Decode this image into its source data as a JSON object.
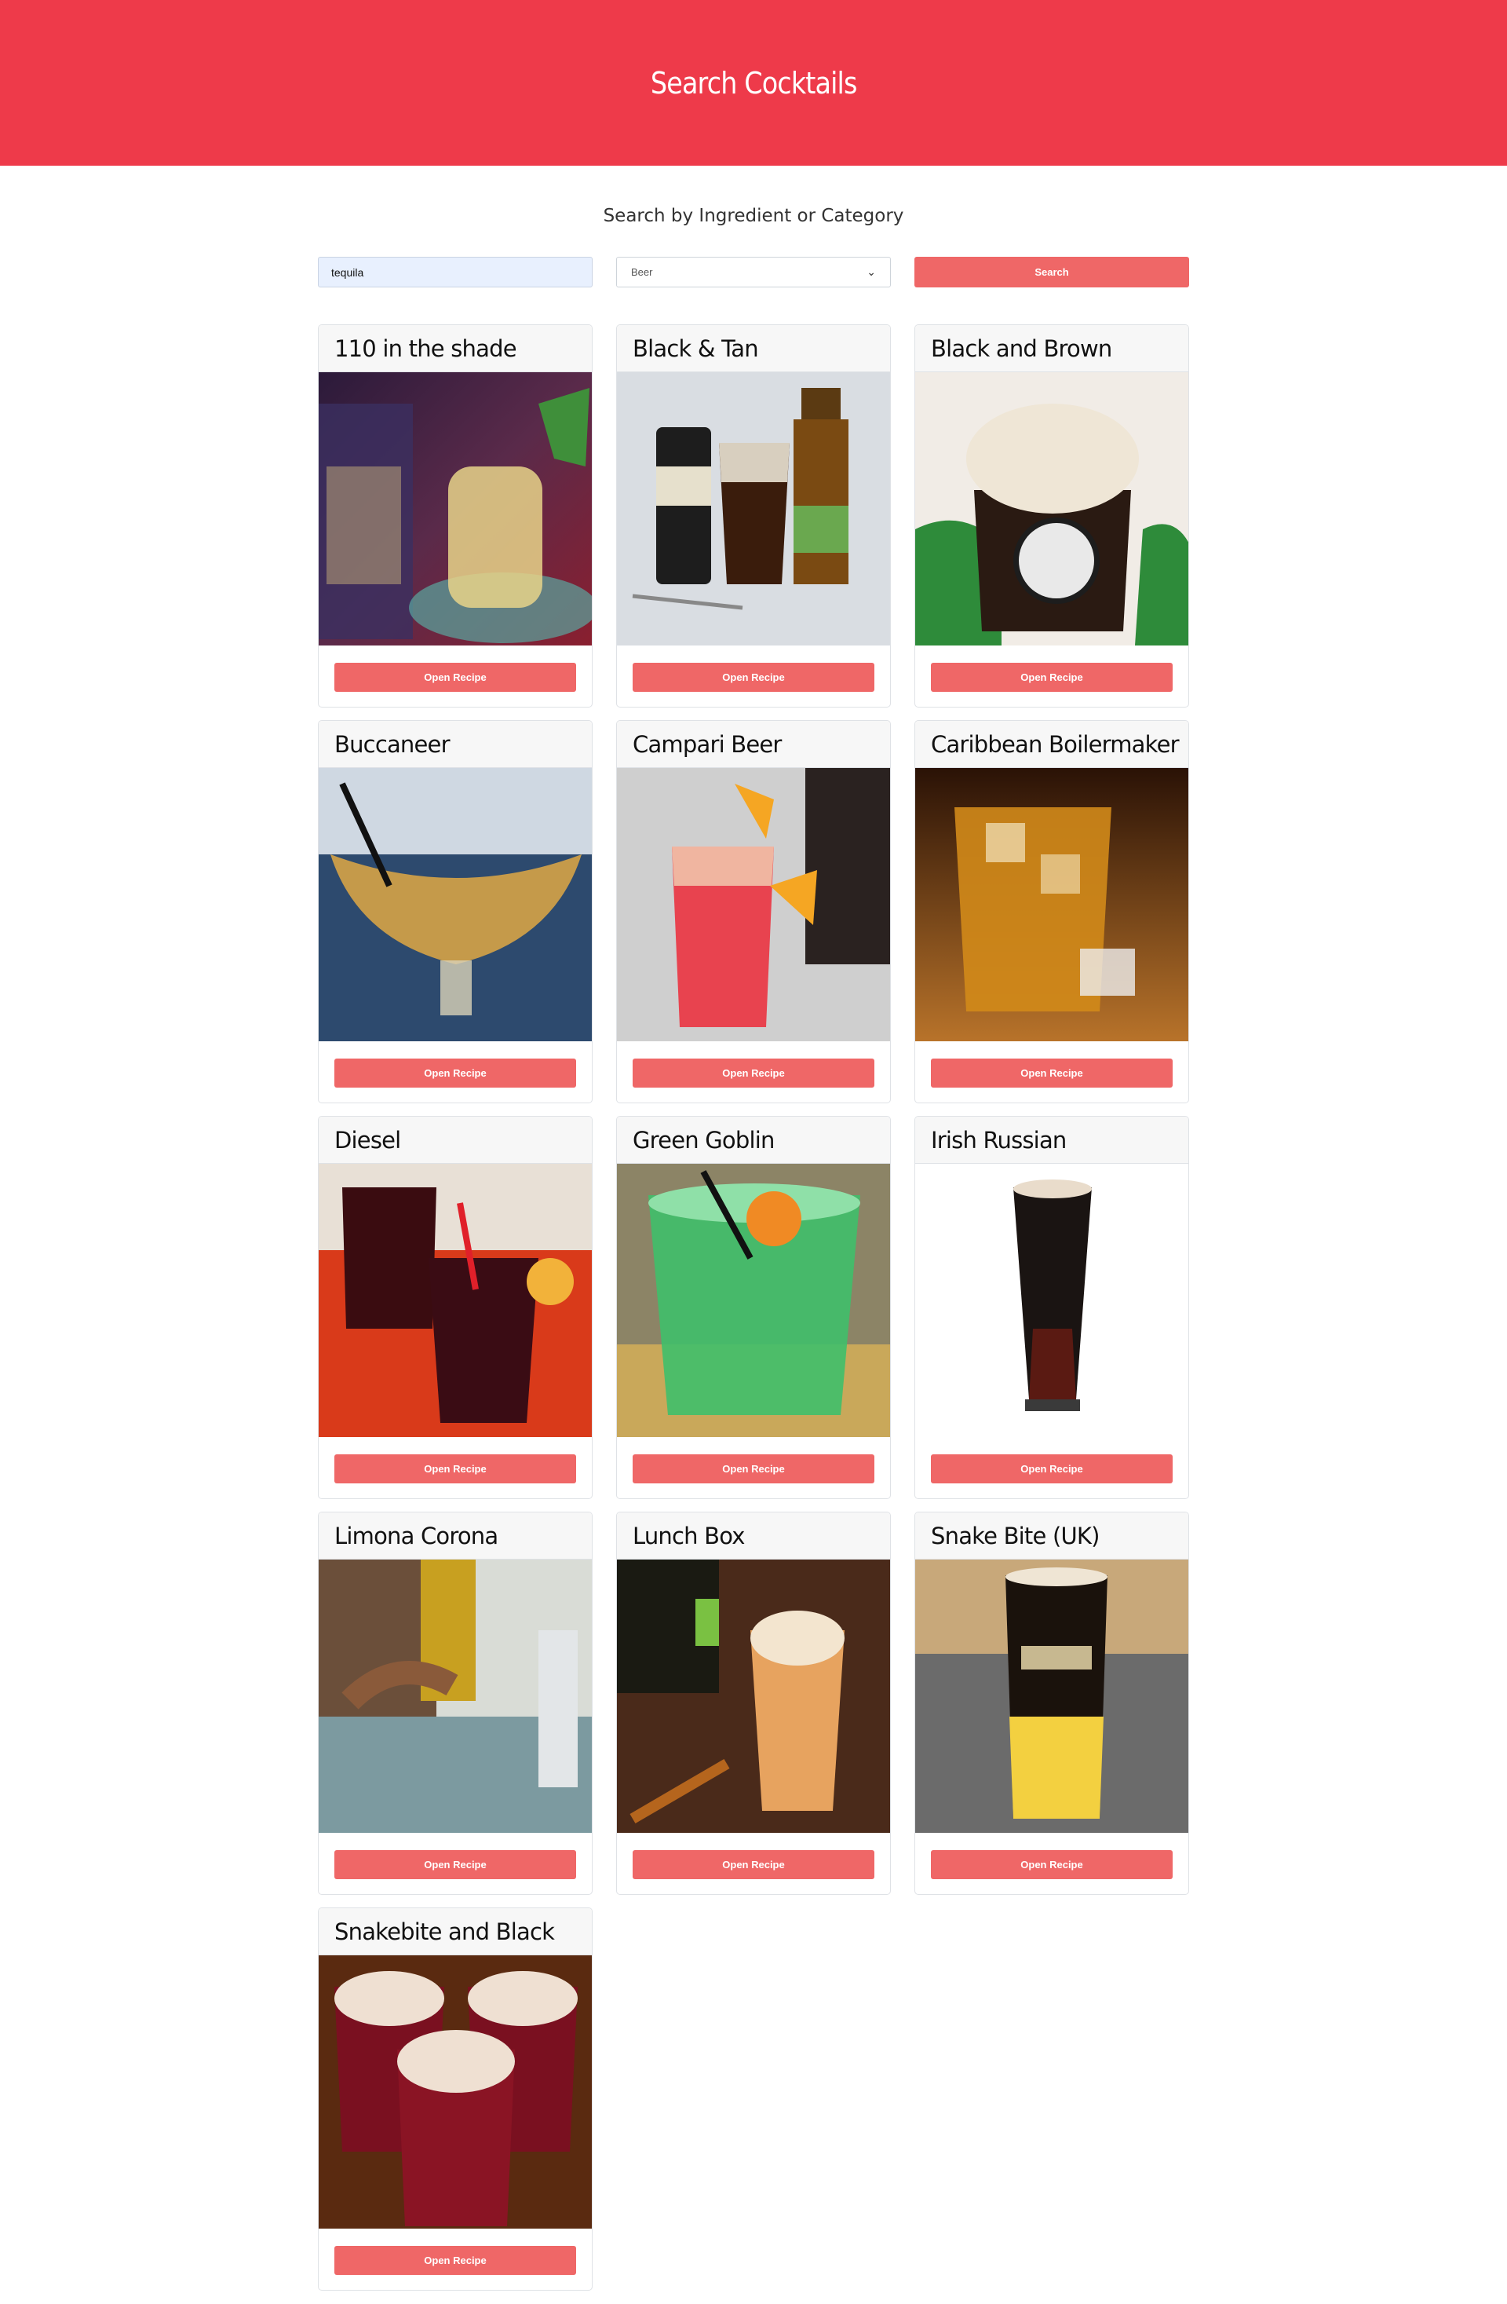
{
  "header": {
    "title": "Search Cocktails"
  },
  "search": {
    "subtitle": "Search by Ingredient or Category",
    "input_value": "tequila",
    "select_value": "Beer",
    "button_label": "Search"
  },
  "cards": [
    {
      "title": "110 in the shade",
      "button_label": "Open Recipe"
    },
    {
      "title": "Black & Tan",
      "button_label": "Open Recipe"
    },
    {
      "title": "Black and Brown",
      "button_label": "Open Recipe"
    },
    {
      "title": "Buccaneer",
      "button_label": "Open Recipe"
    },
    {
      "title": "Campari Beer",
      "button_label": "Open Recipe"
    },
    {
      "title": "Caribbean Boilermaker",
      "button_label": "Open Recipe"
    },
    {
      "title": "Diesel",
      "button_label": "Open Recipe"
    },
    {
      "title": "Green Goblin",
      "button_label": "Open Recipe"
    },
    {
      "title": "Irish Russian",
      "button_label": "Open Recipe"
    },
    {
      "title": "Limona Corona",
      "button_label": "Open Recipe"
    },
    {
      "title": "Lunch Box",
      "button_label": "Open Recipe"
    },
    {
      "title": "Snake Bite (UK)",
      "button_label": "Open Recipe"
    },
    {
      "title": "Snakebite and Black",
      "button_label": "Open Recipe"
    }
  ],
  "colors": {
    "brand": "#ee3a4a",
    "button": "#ef6767",
    "input_bg": "#e8f0fe"
  },
  "icons": {
    "select_chevron": "chevron-down-icon"
  }
}
